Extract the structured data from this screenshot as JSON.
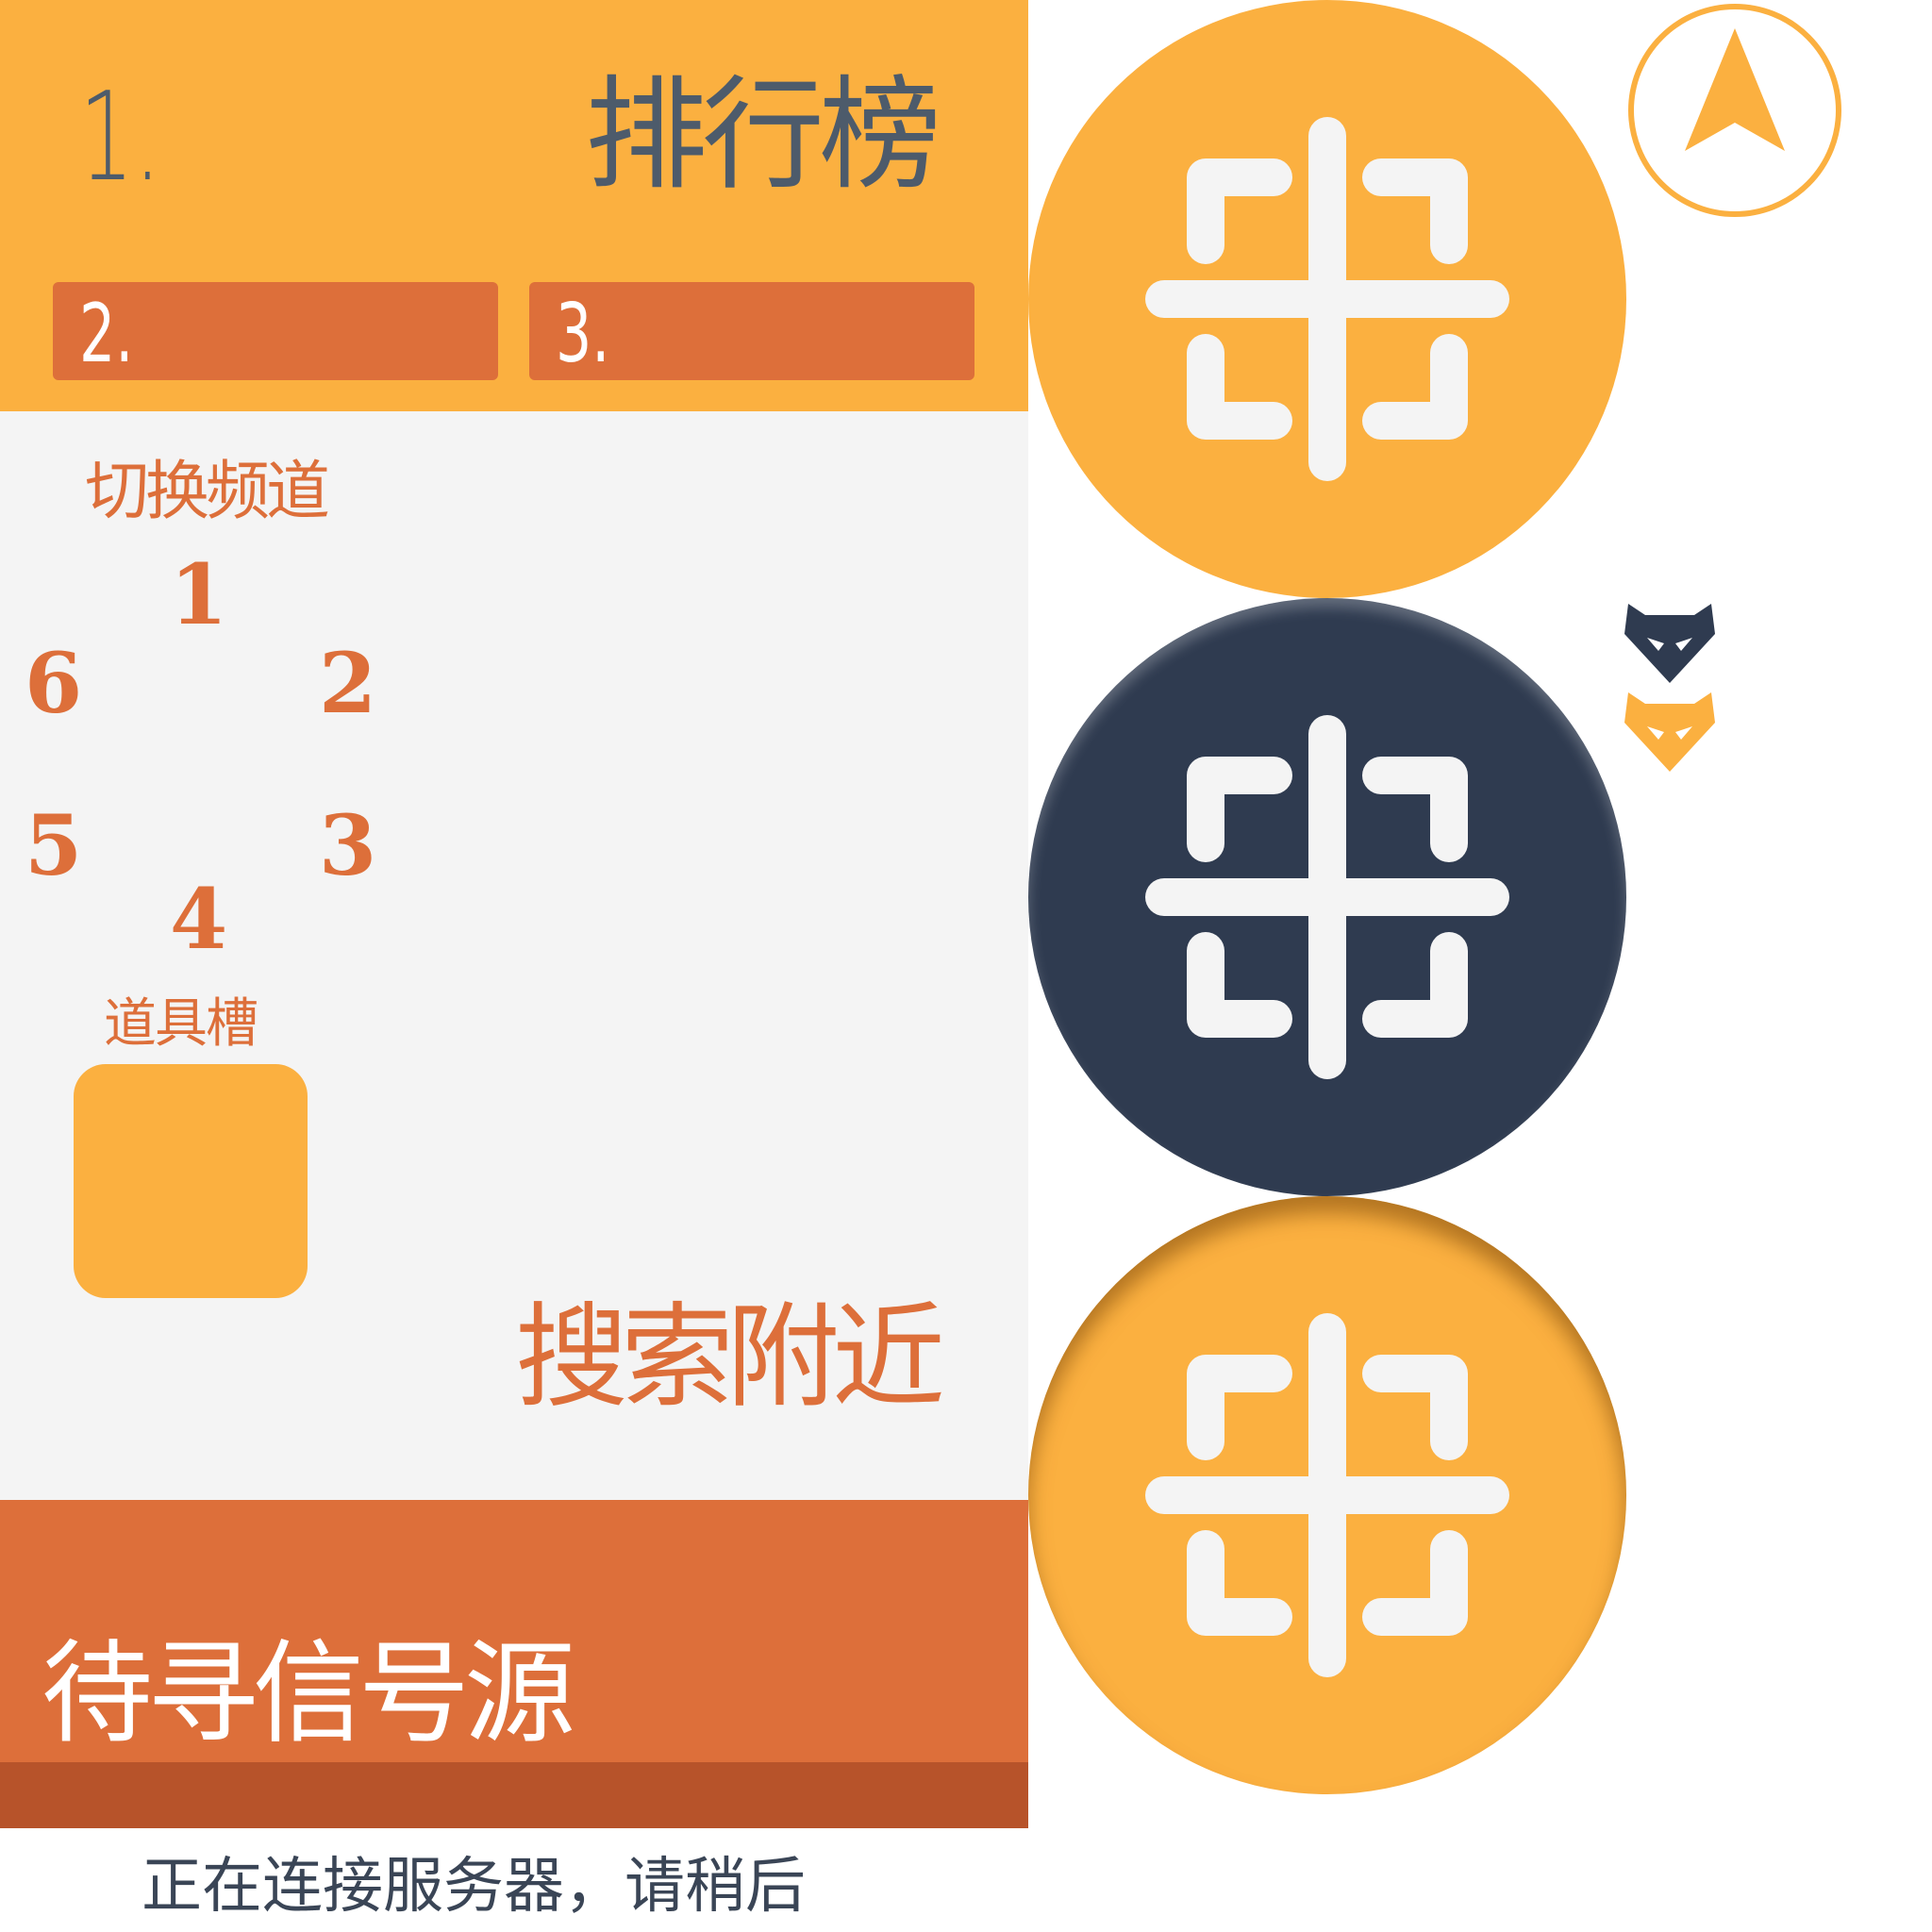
{
  "leaderboard": {
    "title": "排行榜",
    "rank_1": "1.",
    "rank_2": "2.",
    "rank_3": "3."
  },
  "channel": {
    "title": "切换频道",
    "numbers": [
      "1",
      "2",
      "3",
      "4",
      "5",
      "6"
    ]
  },
  "item_slot": {
    "title": "道具槽"
  },
  "search": {
    "label": "搜索附近"
  },
  "status": {
    "signal": "待寻信号源",
    "connection": "正在连接服务器，请稍后"
  },
  "buttons": {
    "top": {
      "icon": "crosshair-icon",
      "color": "#fbb040",
      "state": "normal"
    },
    "middle": {
      "icon": "crosshair-icon",
      "color": "#2f3b50",
      "state": "highlighted"
    },
    "bottom": {
      "icon": "crosshair-icon",
      "color": "#fbb040",
      "state": "pressed"
    }
  },
  "icons": {
    "compass": "navigation-arrow-icon",
    "marker_dark": "fox-marker-icon",
    "marker_orange": "fox-marker-icon"
  },
  "colors": {
    "primary_orange": "#fbb040",
    "accent_orange": "#dd6f3a",
    "dark_orange": "#b7532a",
    "navy": "#2f3b50",
    "text_gray": "#4d5b6b",
    "panel_bg": "#f4f4f4"
  }
}
